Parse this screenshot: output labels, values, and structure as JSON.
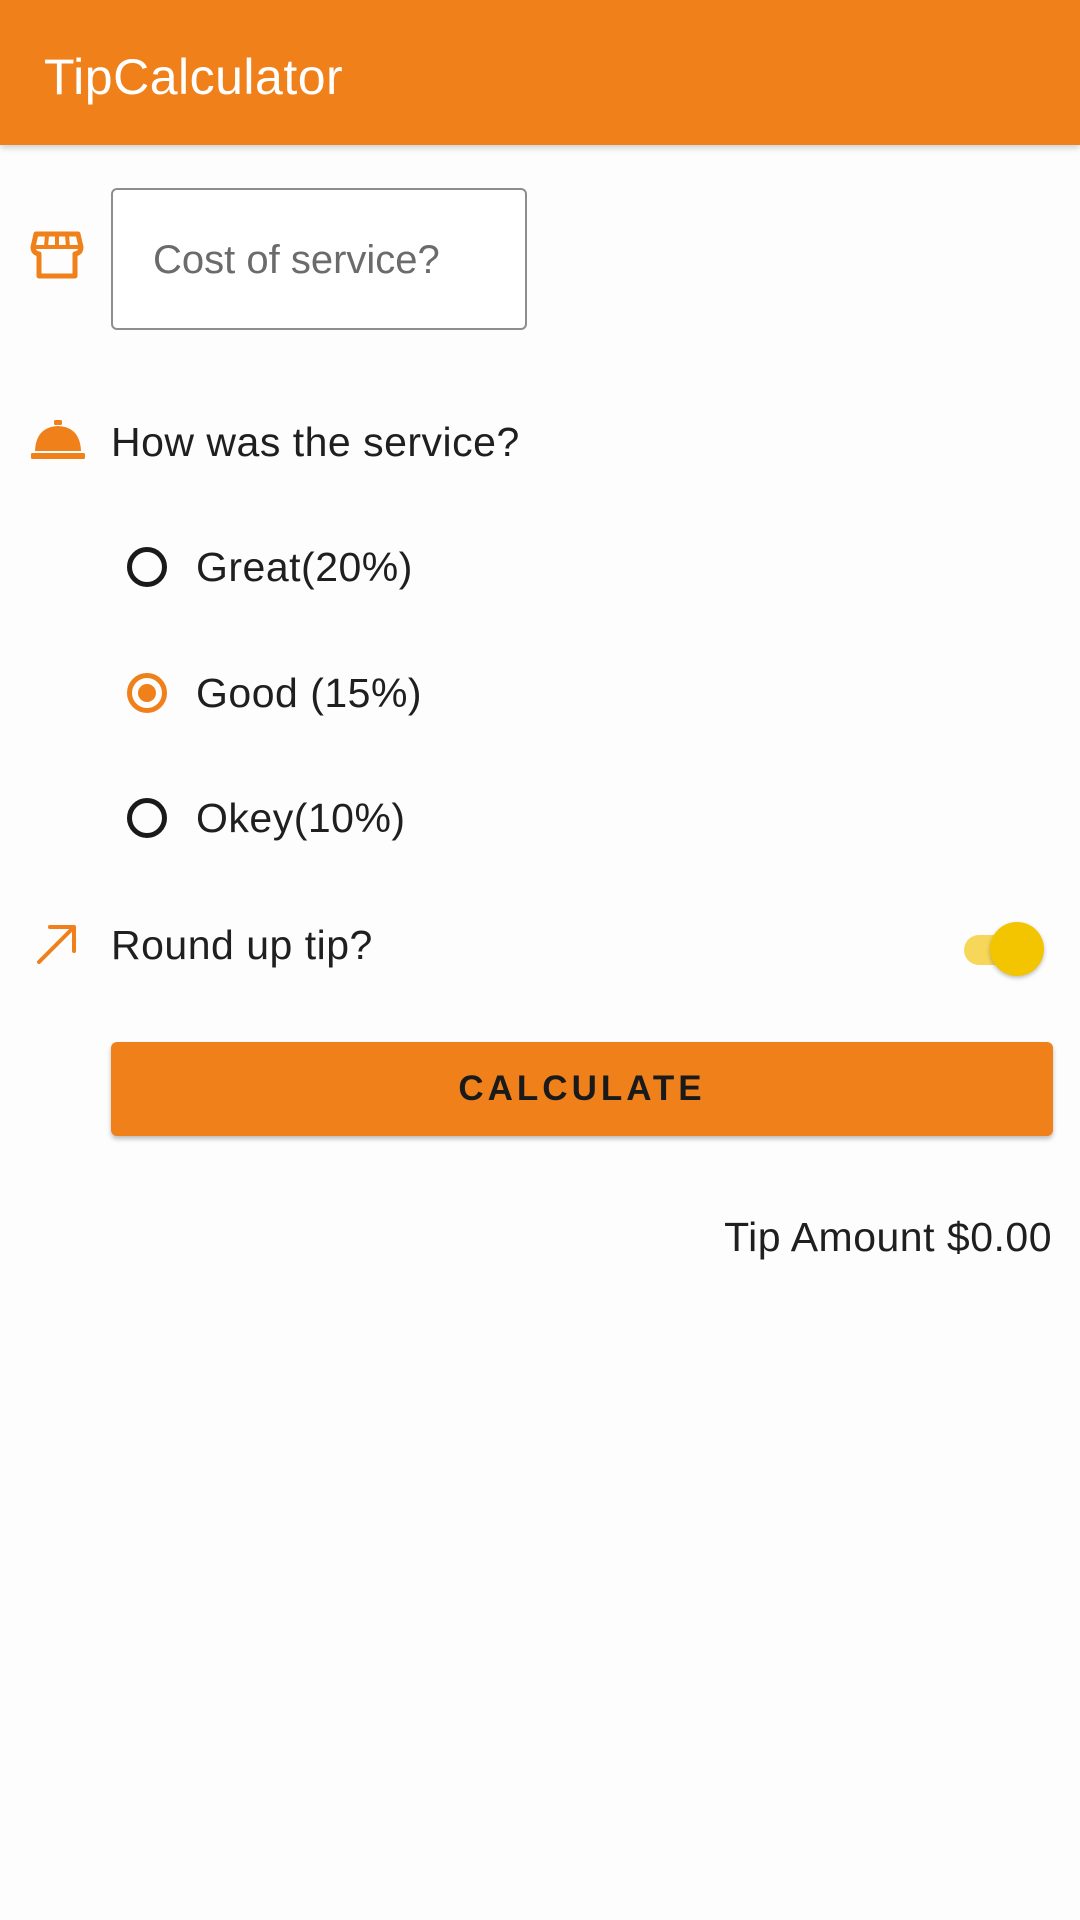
{
  "app": {
    "title": "TipCalculator"
  },
  "colors": {
    "primary": "#f0801a",
    "switch_thumb": "#f2c500",
    "switch_track": "#f7d75a",
    "text": "#1f1f1f"
  },
  "cost_input": {
    "placeholder": "Cost of service?",
    "value": "",
    "icon": "store-icon"
  },
  "service_question": {
    "label": "How was the service?",
    "icon": "service-bell-icon"
  },
  "tip_options": [
    {
      "label": "Great(20%)",
      "selected": false
    },
    {
      "label": "Good (15%)",
      "selected": true
    },
    {
      "label": "Okey(10%)",
      "selected": false
    }
  ],
  "round_up": {
    "label": "Round up tip?",
    "icon": "trending-up-arrow-icon",
    "enabled": true
  },
  "calculate_button": {
    "label": "CALCULATE"
  },
  "result": {
    "text": "Tip Amount $0.00"
  }
}
